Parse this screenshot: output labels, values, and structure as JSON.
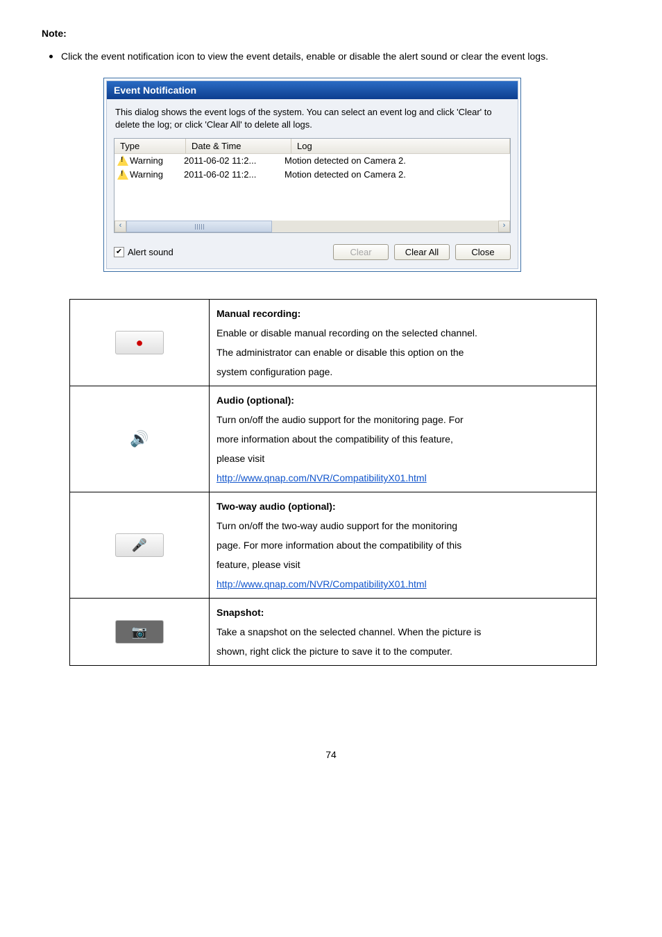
{
  "note_label": "Note:",
  "note_bullet": "Click the event notification icon to view the event details, enable or disable the alert sound or clear the event logs.",
  "dialog": {
    "title": "Event Notification",
    "description": "This dialog shows the event logs of the system. You can select an event log and click 'Clear' to delete the log; or click 'Clear All' to delete all logs.",
    "columns": {
      "type": "Type",
      "date": "Date & Time",
      "log": "Log"
    },
    "rows": [
      {
        "type": "Warning",
        "date": "2011-06-02 11:2...",
        "log": "Motion detected on Camera 2."
      },
      {
        "type": "Warning",
        "date": "2011-06-02 11:2...",
        "log": "Motion detected on Camera 2."
      }
    ],
    "alert_sound": "Alert sound",
    "buttons": {
      "clear": "Clear",
      "clear_all": "Clear All",
      "close": "Close"
    }
  },
  "table": {
    "row1": {
      "title": "Manual recording:",
      "l1": "Enable or disable manual recording on the selected channel.",
      "l2": "The administrator can enable or disable this option on the",
      "l3": "system configuration page."
    },
    "row2": {
      "title": "Audio (optional):",
      "l1": "Turn on/off the audio support for the monitoring page.   For",
      "l2": "more information about the compatibility of this feature,",
      "l3": "please visit",
      "link": "http://www.qnap.com/NVR/CompatibilityX01.html"
    },
    "row3": {
      "title": "Two-way audio (optional):",
      "l1": "Turn on/off the two-way audio support for the monitoring",
      "l2": "page.   For more information about the compatibility of this",
      "l3": "feature, please visit",
      "link": "http://www.qnap.com/NVR/CompatibilityX01.html"
    },
    "row4": {
      "title": "Snapshot:",
      "l1": "Take a snapshot on the selected channel.   When the picture is",
      "l2": "shown, right click the picture to save it to the computer."
    }
  },
  "icons": {
    "record": "●",
    "audio": "🔊",
    "mic": "🎤",
    "snapshot": "📷"
  },
  "page_number": "74"
}
